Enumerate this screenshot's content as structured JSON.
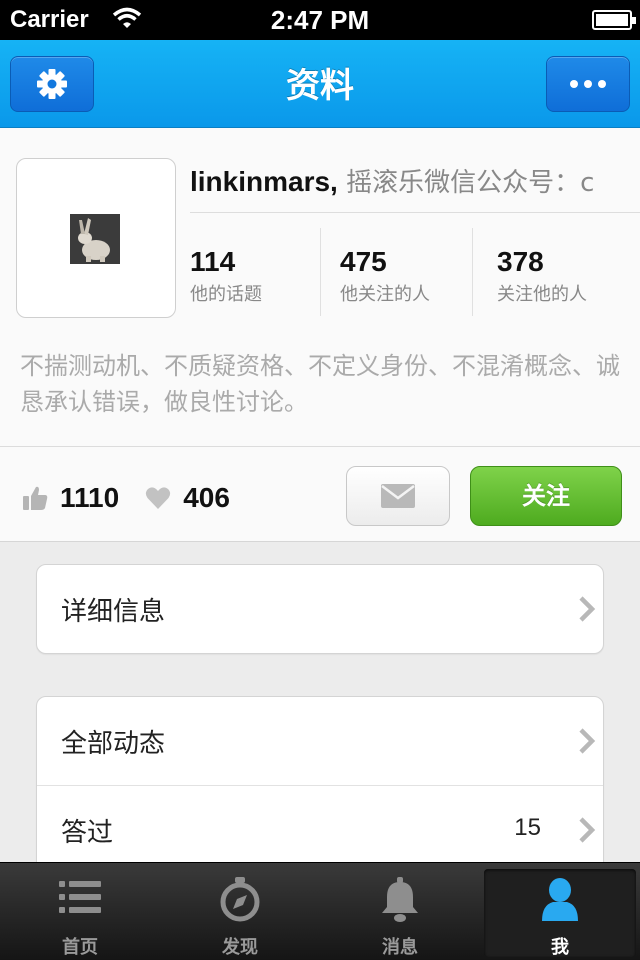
{
  "status_bar": {
    "carrier": "Carrier",
    "time": "2:47 PM"
  },
  "nav": {
    "title": "资料",
    "left_icon": "gear-icon",
    "right_icon": "more-icon"
  },
  "profile": {
    "username": "linkinmars,",
    "bio": " 摇滚乐微信公众号：c",
    "stats": [
      {
        "value": "114",
        "label": "他的话题"
      },
      {
        "value": "475",
        "label": "他关注的人"
      },
      {
        "value": "378",
        "label": "关注他的人"
      }
    ],
    "signature": "不揣测动机、不质疑资格、不定义身份、不混淆概念、诚恳承认错误，做良性讨论。",
    "likes": "1110",
    "favorites": "406",
    "follow_label": "关注"
  },
  "menu": {
    "detail_label": "详细信息",
    "items": [
      {
        "label": "全部动态",
        "value": ""
      },
      {
        "label": "答过",
        "value": "15"
      }
    ]
  },
  "tabs": [
    {
      "label": "首页",
      "icon": "list-icon"
    },
    {
      "label": "发现",
      "icon": "compass-icon"
    },
    {
      "label": "消息",
      "icon": "bell-icon"
    },
    {
      "label": "我",
      "icon": "user-icon"
    }
  ],
  "colors": {
    "nav_blue": "#0a98ea",
    "follow_green": "#5fbf2c",
    "active_tab_icon": "#29a9f0"
  }
}
